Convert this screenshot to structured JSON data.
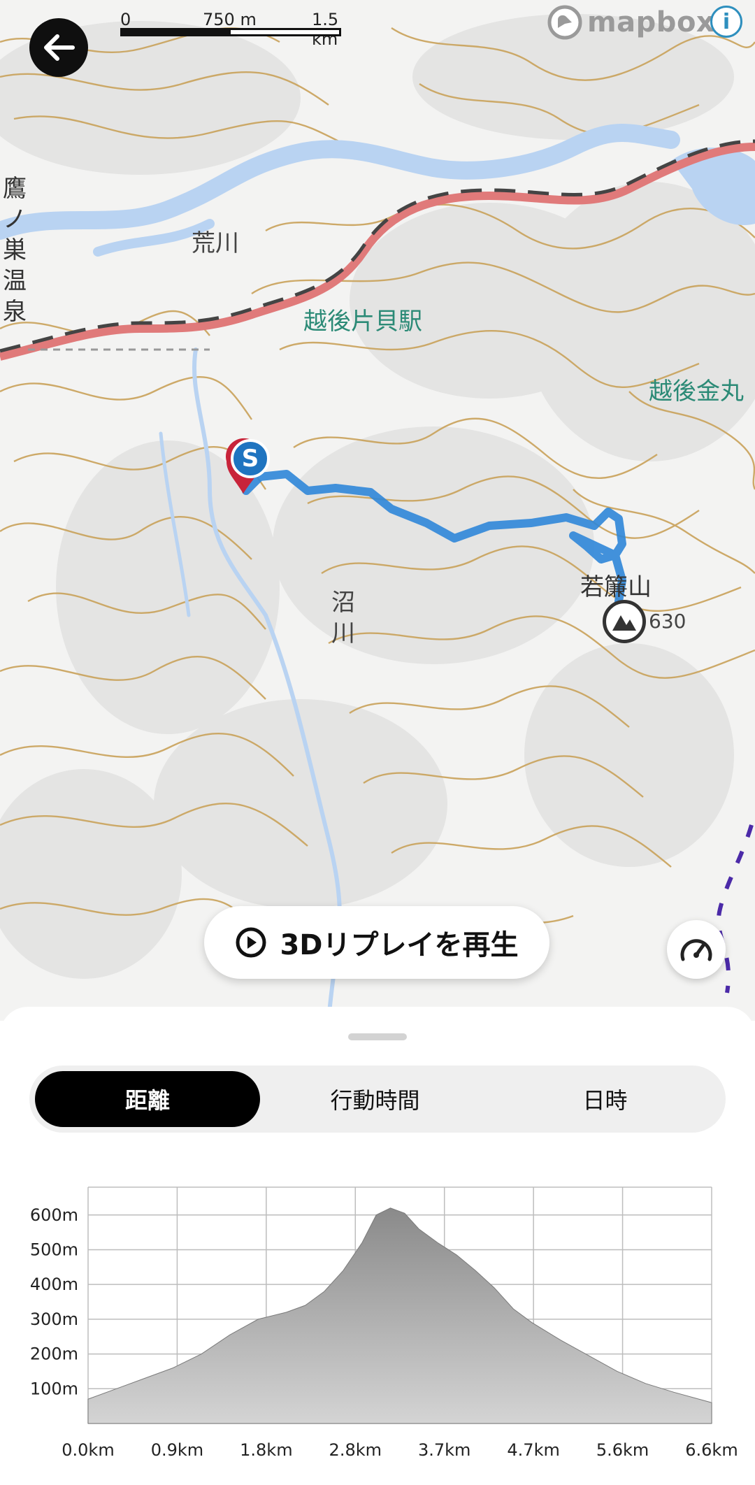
{
  "map": {
    "scale": {
      "labels": [
        "0",
        "750 m",
        "1.5 km"
      ]
    },
    "attribution": {
      "brand": "mapbox",
      "info_symbol": "i"
    },
    "place_labels": {
      "takanosu": "鷹ノ巣温泉",
      "arakawa": "荒川",
      "katakai": "越後片貝駅",
      "kanamaru": "越後金丸",
      "numakawa": "沼川",
      "mountain": "若簾山",
      "elevation": "630"
    },
    "start_marker": "S",
    "icons": {
      "back": "arrow-left-icon",
      "summit": "mountain-icon",
      "play": "play-icon",
      "speed": "speedometer-icon"
    },
    "colors": {
      "route": "#2f86d8",
      "contour": "#c9a25a",
      "river": "#b9d3f2",
      "rail": "#e07a7a"
    }
  },
  "replay_button": {
    "label": "3Dリプレイを再生"
  },
  "tabs": [
    {
      "label": "距離",
      "active": true
    },
    {
      "label": "行動時間",
      "active": false
    },
    {
      "label": "日時",
      "active": false
    }
  ],
  "chart_data": {
    "type": "area",
    "x_ticks": [
      "0.0km",
      "0.9km",
      "1.8km",
      "2.8km",
      "3.7km",
      "4.7km",
      "5.6km",
      "6.6km"
    ],
    "y_ticks": [
      "100m",
      "200m",
      "300m",
      "400m",
      "500m",
      "600m"
    ],
    "xlim": [
      0,
      6.6
    ],
    "ylim": [
      0,
      680
    ],
    "x": [
      0,
      0.3,
      0.6,
      0.9,
      1.2,
      1.5,
      1.8,
      2.1,
      2.3,
      2.5,
      2.7,
      2.9,
      3.05,
      3.2,
      3.35,
      3.5,
      3.7,
      3.9,
      4.1,
      4.3,
      4.5,
      4.7,
      5.0,
      5.3,
      5.6,
      5.9,
      6.2,
      6.6
    ],
    "y": [
      70,
      100,
      130,
      160,
      200,
      255,
      300,
      320,
      340,
      380,
      440,
      520,
      600,
      620,
      605,
      560,
      520,
      485,
      440,
      390,
      330,
      290,
      240,
      195,
      150,
      115,
      90,
      60
    ],
    "series": [
      {
        "values_ref": "y"
      }
    ],
    "grid": true,
    "fill_color": "#9a9a9a"
  }
}
